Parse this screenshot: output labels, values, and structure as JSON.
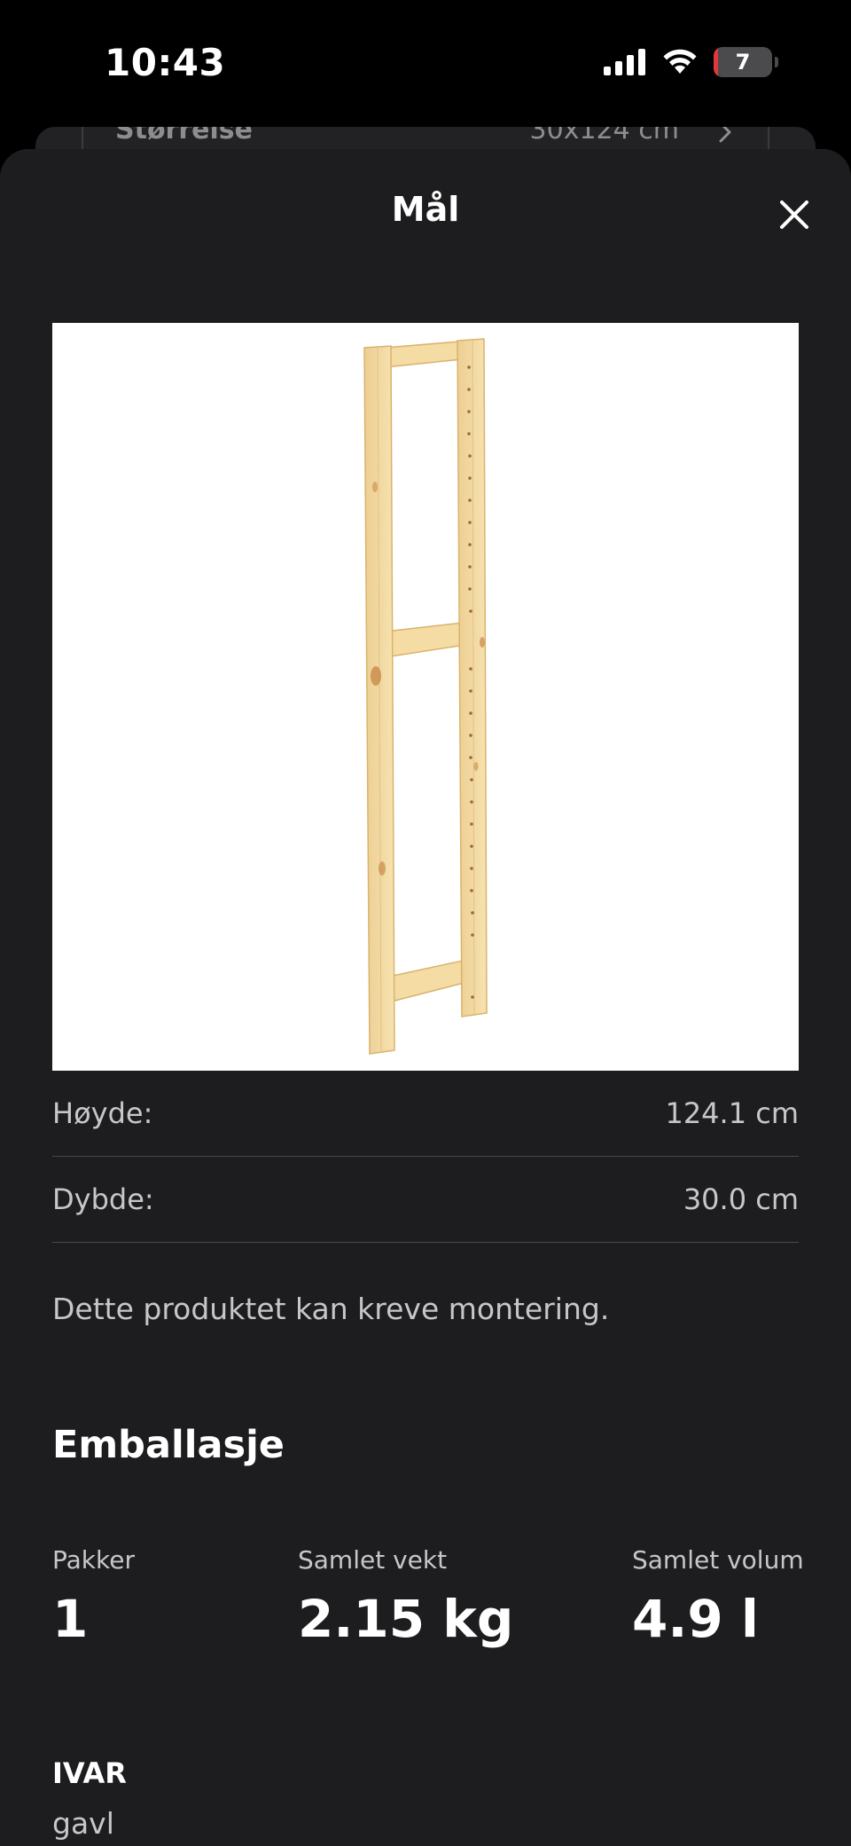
{
  "status_bar": {
    "time": "10:43",
    "battery_level": "7",
    "battery_fill_percent": 7,
    "battery_color": "#e0383e",
    "icons": [
      "signal-icon",
      "wifi-icon",
      "battery-icon"
    ]
  },
  "background_page": {
    "row_label": "Størrelse",
    "row_value": "30x124 cm"
  },
  "sheet": {
    "title": "Mål",
    "close_icon": "close-icon"
  },
  "product_image": {
    "icon": "shelf-side-unit-illustration"
  },
  "dimensions": [
    {
      "label": "Høyde:",
      "value": "124.1 cm"
    },
    {
      "label": "Dybde:",
      "value": "30.0 cm"
    }
  ],
  "assembly_note": "Dette produktet kan kreve montering.",
  "packaging": {
    "heading": "Emballasje",
    "packages_label": "Pakker",
    "packages_value": "1",
    "weight_label": "Samlet vekt",
    "weight_value": "2.15 kg",
    "volume_label": "Samlet volum",
    "volume_value": "4.9 l"
  },
  "product": {
    "name": "IVAR",
    "type": "gavl"
  }
}
